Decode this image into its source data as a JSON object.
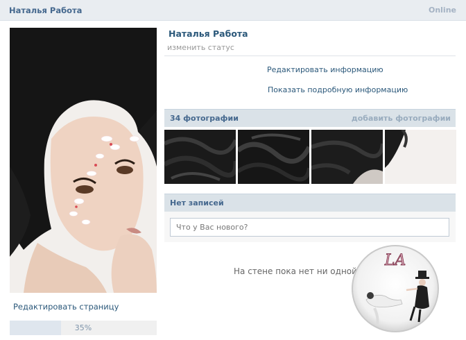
{
  "topbar": {
    "name": "Наталья Работа",
    "online": "Online"
  },
  "left": {
    "edit_page": "Редактировать страницу",
    "progress": {
      "fraction": 0.35,
      "label": "35%"
    }
  },
  "profile": {
    "name": "Наталья Работа",
    "status": "изменить статус",
    "edit_info": "Редактировать информацию",
    "show_info": "Показать подробную информацию"
  },
  "photos": {
    "count": "34 фотографии",
    "add": "добавить фотографии"
  },
  "wall": {
    "title": "Нет записей",
    "placeholder": "Что у Вас нового?",
    "empty": "На стене пока нет ни одной записи"
  },
  "watermark": {
    "text": "LA"
  },
  "colors": {
    "link": "#2b587a",
    "header_bg": "#dae2e8",
    "topbar_bg": "#e9edf1"
  }
}
